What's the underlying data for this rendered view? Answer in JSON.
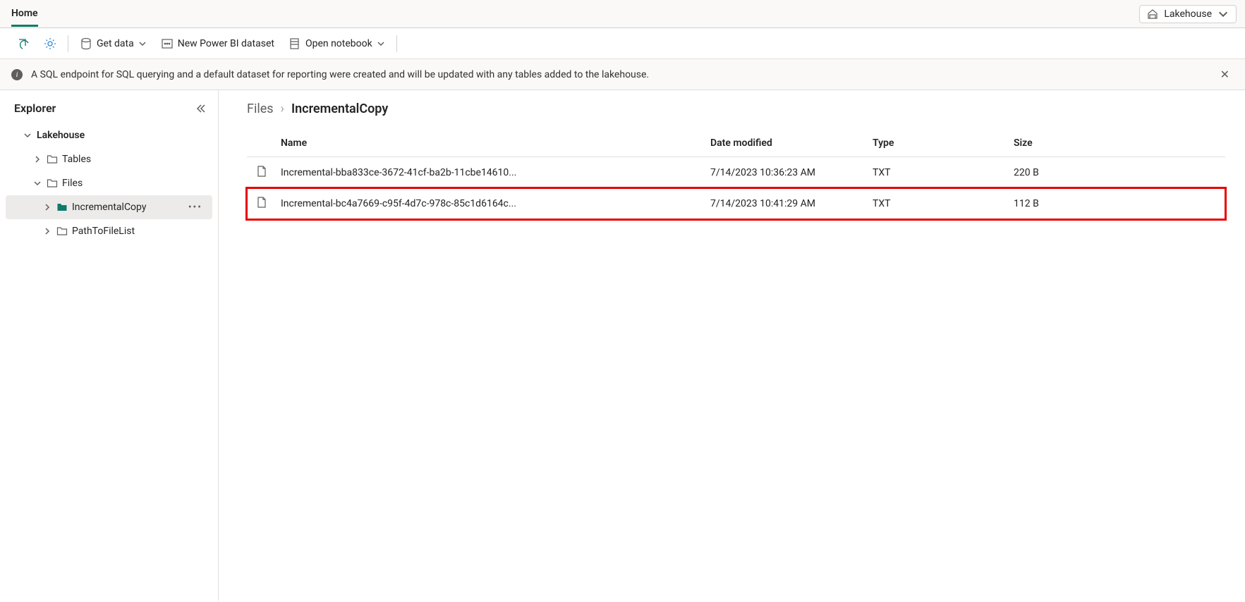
{
  "top": {
    "tab_home": "Home",
    "switcher_label": "Lakehouse"
  },
  "toolbar": {
    "get_data": "Get data",
    "new_dataset": "New Power BI dataset",
    "open_notebook": "Open notebook"
  },
  "banner": {
    "text": "A SQL endpoint for SQL querying and a default dataset for reporting were created and will be updated with any tables added to the lakehouse."
  },
  "sidebar": {
    "title": "Explorer",
    "root": "Lakehouse",
    "tables": "Tables",
    "files": "Files",
    "incremental": "IncrementalCopy",
    "path_to": "PathToFileList"
  },
  "breadcrumb": {
    "root": "Files",
    "current": "IncrementalCopy"
  },
  "columns": {
    "name": "Name",
    "modified": "Date modified",
    "type": "Type",
    "size": "Size"
  },
  "rows": [
    {
      "name": "Incremental-bba833ce-3672-41cf-ba2b-11cbe14610...",
      "modified": "7/14/2023 10:36:23 AM",
      "type": "TXT",
      "size": "220 B",
      "highlight": false
    },
    {
      "name": "Incremental-bc4a7669-c95f-4d7c-978c-85c1d6164c...",
      "modified": "7/14/2023 10:41:29 AM",
      "type": "TXT",
      "size": "112 B",
      "highlight": true
    }
  ]
}
